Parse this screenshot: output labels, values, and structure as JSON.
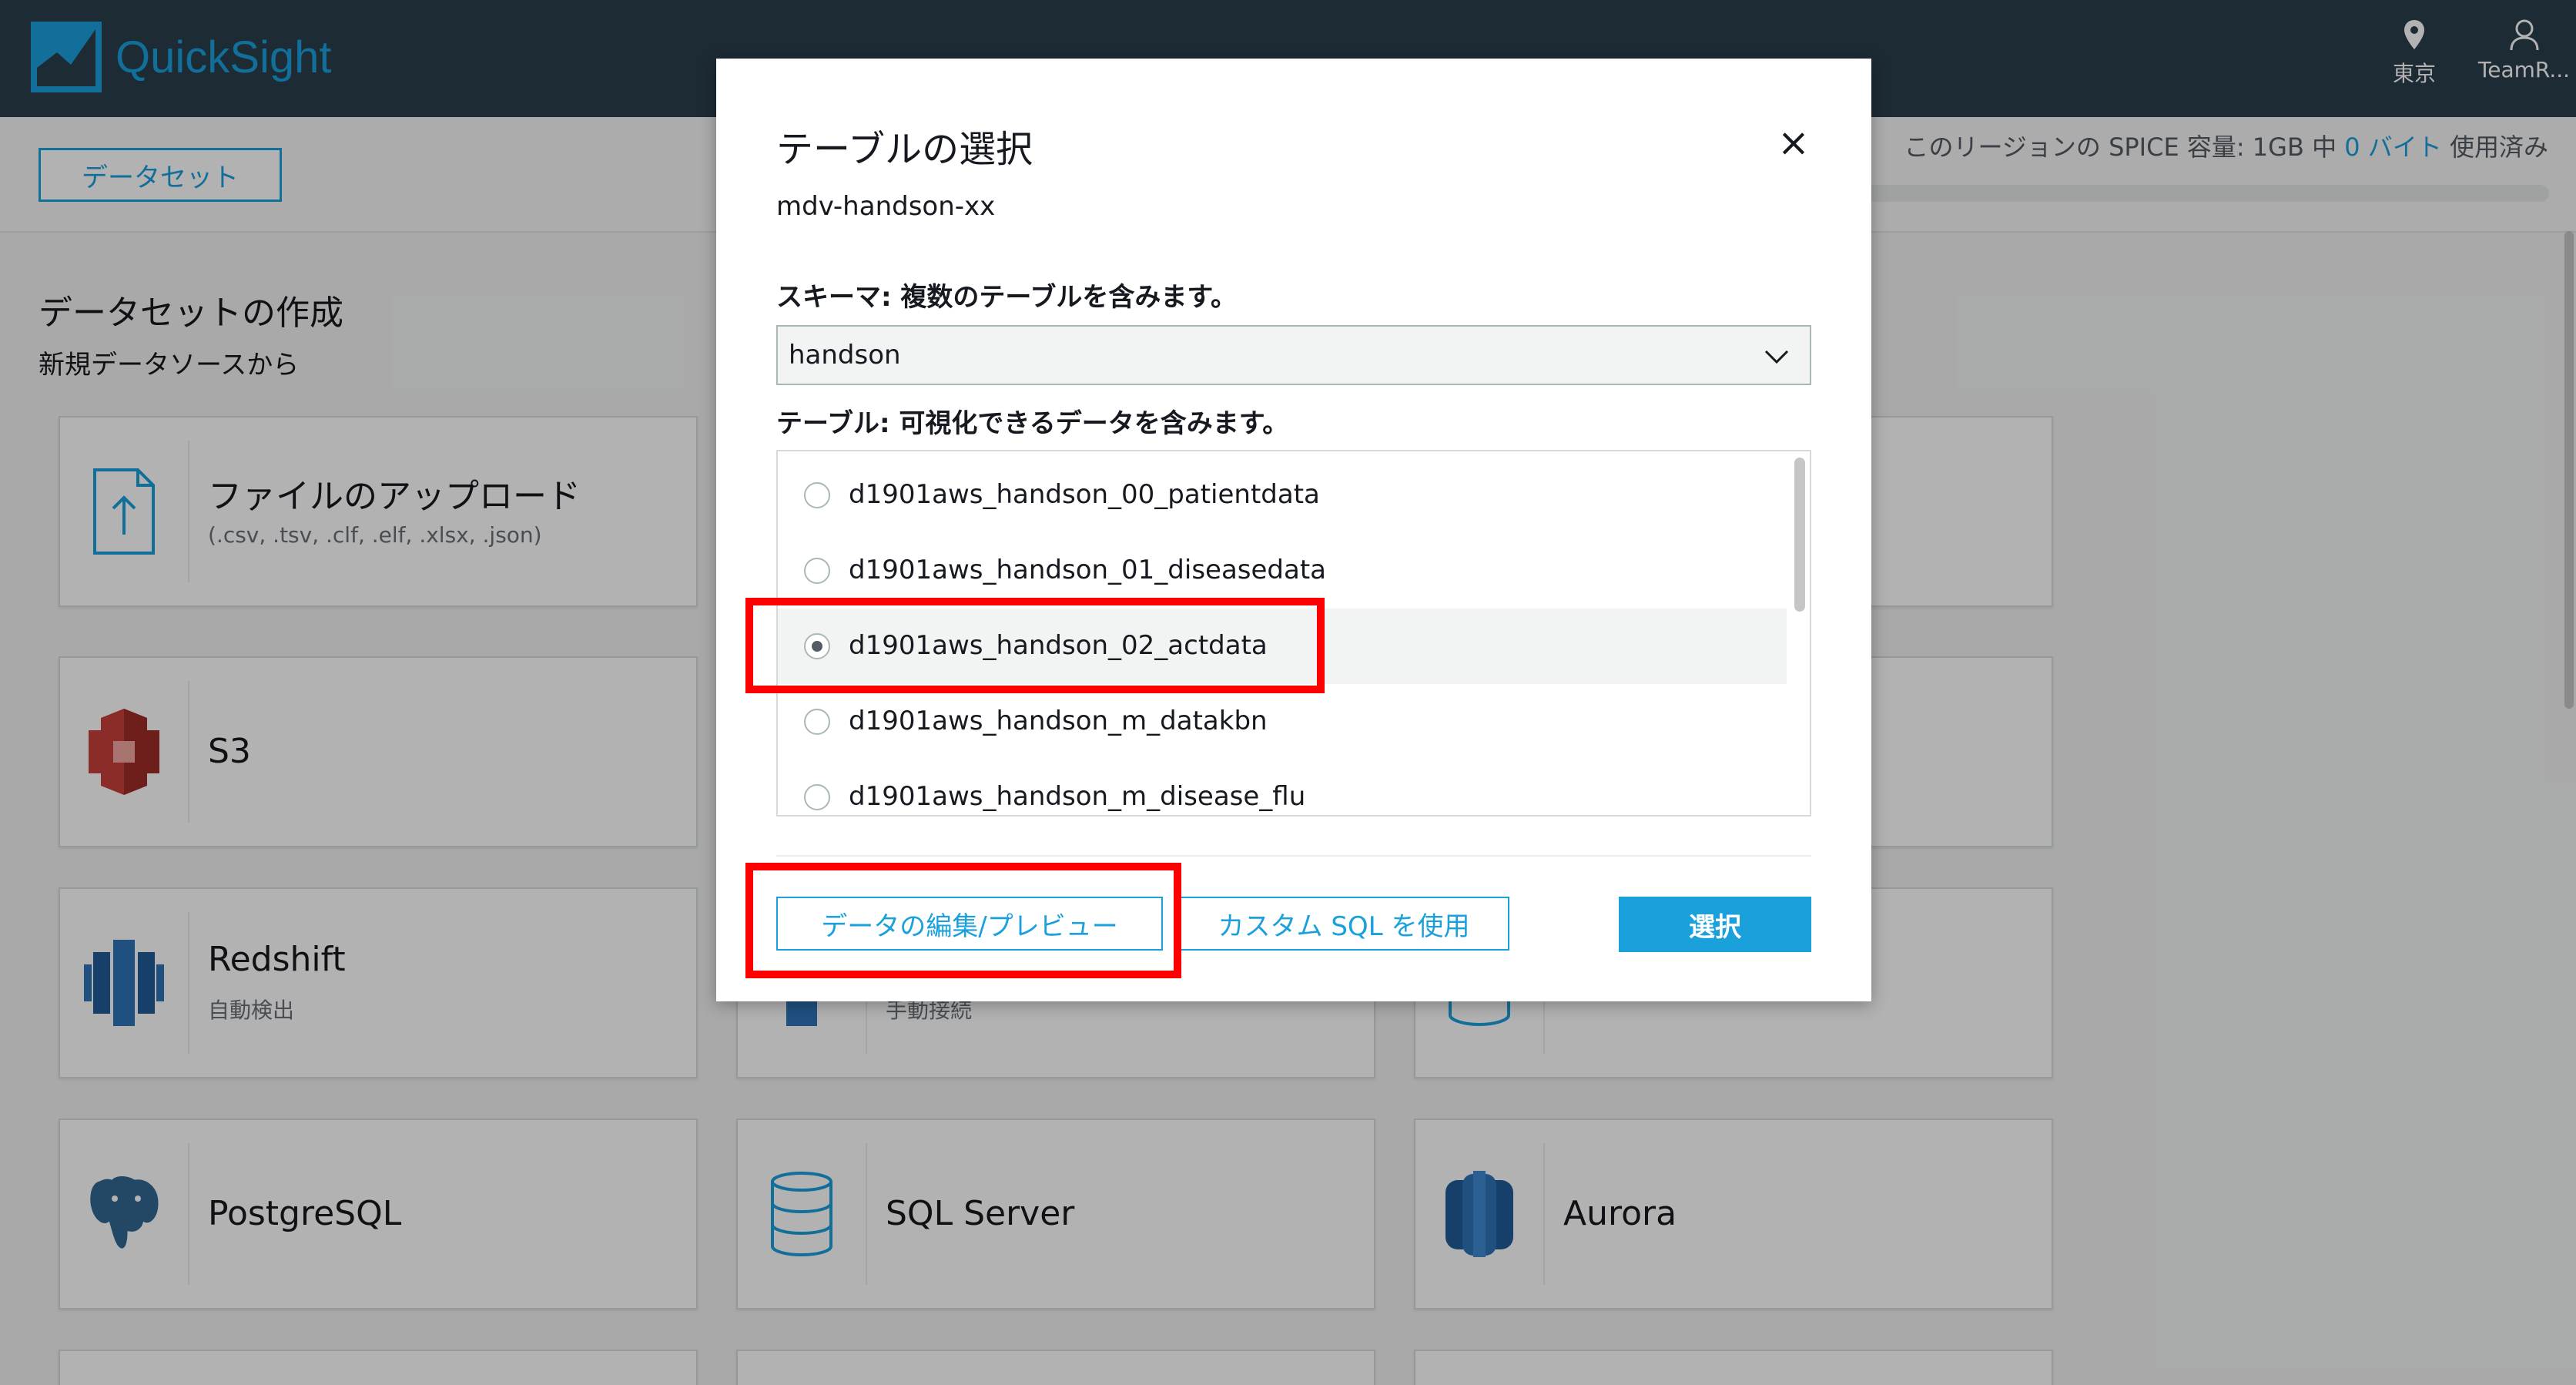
{
  "app": {
    "name": "QuickSight"
  },
  "nav": {
    "region": "東京",
    "user": "TeamR..."
  },
  "toolbar": {
    "datasets_button": "データセット"
  },
  "spice": {
    "prefix": "このリージョンの SPICE 容量: 1GB 中 ",
    "used": "0 バイト",
    "suffix": " 使用済み"
  },
  "main": {
    "title": "データセットの作成",
    "subtitle": "新規データソースから",
    "sources": [
      {
        "name": "ファイルのアップロード",
        "desc": "(.csv, .tsv, .clf, .elf, .xlsx, .json)"
      },
      {
        "name": "S3",
        "desc": ""
      },
      {
        "name": "Redshift",
        "desc": "自動検出"
      },
      {
        "name": "",
        "desc": "手動接続"
      },
      {
        "name": "PostgreSQL",
        "desc": ""
      },
      {
        "name": "SQL Server",
        "desc": ""
      },
      {
        "name": "Aurora",
        "desc": ""
      }
    ]
  },
  "modal": {
    "title": "テーブルの選択",
    "datasource": "mdv-handson-xx",
    "close_icon": "×",
    "schema_label": "スキーマ: 複数のテーブルを含みます。",
    "schema_value": "handson",
    "table_label": "テーブル: 可視化できるデータを含みます。",
    "tables": [
      {
        "name": "d1901aws_handson_00_patientdata",
        "selected": false
      },
      {
        "name": "d1901aws_handson_01_diseasedata",
        "selected": false
      },
      {
        "name": "d1901aws_handson_02_actdata",
        "selected": true
      },
      {
        "name": "d1901aws_handson_m_datakbn",
        "selected": false
      },
      {
        "name": "d1901aws_handson_m_disease_flu",
        "selected": false
      }
    ],
    "edit_preview_button": "データの編集/プレビュー",
    "custom_sql_button": "カスタム SQL を使用",
    "select_button": "選択"
  },
  "colors": {
    "accent": "#1aa0db",
    "nav_bg": "#2a3e4c",
    "highlight": "#ff0000"
  },
  "icons": [
    "quicksight-logo-icon",
    "location-pin-icon",
    "user-icon",
    "file-upload-icon",
    "s3-icon",
    "redshift-icon",
    "postgresql-icon",
    "sql-server-icon",
    "aurora-icon",
    "chevron-down-icon",
    "close-icon"
  ]
}
